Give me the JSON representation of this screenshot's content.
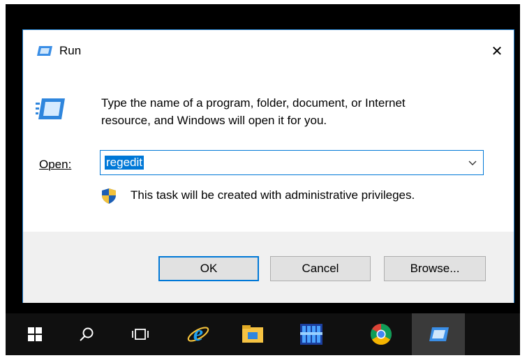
{
  "dialog": {
    "title": "Run",
    "close_glyph": "✕",
    "description_line1": "Type the name of a program, folder, document, or Internet",
    "description_line2": "resource, and Windows will open it for you.",
    "open_label": "Open:",
    "open_value": "regedit",
    "admin_notice": "This task will be created with administrative privileges.",
    "buttons": {
      "ok": "OK",
      "cancel": "Cancel",
      "browse": "Browse..."
    }
  },
  "taskbar": {
    "items": [
      {
        "icon": "windows-start-icon"
      },
      {
        "icon": "search-icon"
      },
      {
        "icon": "task-view-icon"
      },
      {
        "icon": "internet-explorer-icon"
      },
      {
        "icon": "file-explorer-icon"
      },
      {
        "icon": "server-manager-icon"
      },
      {
        "icon": "chrome-icon"
      },
      {
        "icon": "run-icon",
        "active": true
      }
    ]
  },
  "colors": {
    "accent": "#0078d7",
    "footer": "#f0f0f0",
    "taskbar": "#101010"
  }
}
